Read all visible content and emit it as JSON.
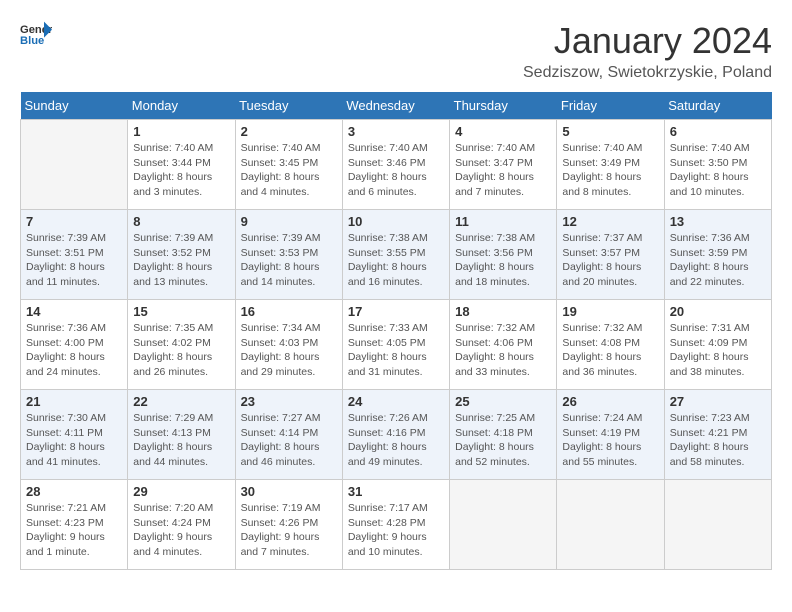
{
  "header": {
    "logo_line1": "General",
    "logo_line2": "Blue",
    "month_title": "January 2024",
    "location": "Sedziszow, Swietokrzyskie, Poland"
  },
  "weekdays": [
    "Sunday",
    "Monday",
    "Tuesday",
    "Wednesday",
    "Thursday",
    "Friday",
    "Saturday"
  ],
  "weeks": [
    [
      {
        "day": "",
        "info": ""
      },
      {
        "day": "1",
        "info": "Sunrise: 7:40 AM\nSunset: 3:44 PM\nDaylight: 8 hours\nand 3 minutes."
      },
      {
        "day": "2",
        "info": "Sunrise: 7:40 AM\nSunset: 3:45 PM\nDaylight: 8 hours\nand 4 minutes."
      },
      {
        "day": "3",
        "info": "Sunrise: 7:40 AM\nSunset: 3:46 PM\nDaylight: 8 hours\nand 6 minutes."
      },
      {
        "day": "4",
        "info": "Sunrise: 7:40 AM\nSunset: 3:47 PM\nDaylight: 8 hours\nand 7 minutes."
      },
      {
        "day": "5",
        "info": "Sunrise: 7:40 AM\nSunset: 3:49 PM\nDaylight: 8 hours\nand 8 minutes."
      },
      {
        "day": "6",
        "info": "Sunrise: 7:40 AM\nSunset: 3:50 PM\nDaylight: 8 hours\nand 10 minutes."
      }
    ],
    [
      {
        "day": "7",
        "info": "Sunrise: 7:39 AM\nSunset: 3:51 PM\nDaylight: 8 hours\nand 11 minutes."
      },
      {
        "day": "8",
        "info": "Sunrise: 7:39 AM\nSunset: 3:52 PM\nDaylight: 8 hours\nand 13 minutes."
      },
      {
        "day": "9",
        "info": "Sunrise: 7:39 AM\nSunset: 3:53 PM\nDaylight: 8 hours\nand 14 minutes."
      },
      {
        "day": "10",
        "info": "Sunrise: 7:38 AM\nSunset: 3:55 PM\nDaylight: 8 hours\nand 16 minutes."
      },
      {
        "day": "11",
        "info": "Sunrise: 7:38 AM\nSunset: 3:56 PM\nDaylight: 8 hours\nand 18 minutes."
      },
      {
        "day": "12",
        "info": "Sunrise: 7:37 AM\nSunset: 3:57 PM\nDaylight: 8 hours\nand 20 minutes."
      },
      {
        "day": "13",
        "info": "Sunrise: 7:36 AM\nSunset: 3:59 PM\nDaylight: 8 hours\nand 22 minutes."
      }
    ],
    [
      {
        "day": "14",
        "info": "Sunrise: 7:36 AM\nSunset: 4:00 PM\nDaylight: 8 hours\nand 24 minutes."
      },
      {
        "day": "15",
        "info": "Sunrise: 7:35 AM\nSunset: 4:02 PM\nDaylight: 8 hours\nand 26 minutes."
      },
      {
        "day": "16",
        "info": "Sunrise: 7:34 AM\nSunset: 4:03 PM\nDaylight: 8 hours\nand 29 minutes."
      },
      {
        "day": "17",
        "info": "Sunrise: 7:33 AM\nSunset: 4:05 PM\nDaylight: 8 hours\nand 31 minutes."
      },
      {
        "day": "18",
        "info": "Sunrise: 7:32 AM\nSunset: 4:06 PM\nDaylight: 8 hours\nand 33 minutes."
      },
      {
        "day": "19",
        "info": "Sunrise: 7:32 AM\nSunset: 4:08 PM\nDaylight: 8 hours\nand 36 minutes."
      },
      {
        "day": "20",
        "info": "Sunrise: 7:31 AM\nSunset: 4:09 PM\nDaylight: 8 hours\nand 38 minutes."
      }
    ],
    [
      {
        "day": "21",
        "info": "Sunrise: 7:30 AM\nSunset: 4:11 PM\nDaylight: 8 hours\nand 41 minutes."
      },
      {
        "day": "22",
        "info": "Sunrise: 7:29 AM\nSunset: 4:13 PM\nDaylight: 8 hours\nand 44 minutes."
      },
      {
        "day": "23",
        "info": "Sunrise: 7:27 AM\nSunset: 4:14 PM\nDaylight: 8 hours\nand 46 minutes."
      },
      {
        "day": "24",
        "info": "Sunrise: 7:26 AM\nSunset: 4:16 PM\nDaylight: 8 hours\nand 49 minutes."
      },
      {
        "day": "25",
        "info": "Sunrise: 7:25 AM\nSunset: 4:18 PM\nDaylight: 8 hours\nand 52 minutes."
      },
      {
        "day": "26",
        "info": "Sunrise: 7:24 AM\nSunset: 4:19 PM\nDaylight: 8 hours\nand 55 minutes."
      },
      {
        "day": "27",
        "info": "Sunrise: 7:23 AM\nSunset: 4:21 PM\nDaylight: 8 hours\nand 58 minutes."
      }
    ],
    [
      {
        "day": "28",
        "info": "Sunrise: 7:21 AM\nSunset: 4:23 PM\nDaylight: 9 hours\nand 1 minute."
      },
      {
        "day": "29",
        "info": "Sunrise: 7:20 AM\nSunset: 4:24 PM\nDaylight: 9 hours\nand 4 minutes."
      },
      {
        "day": "30",
        "info": "Sunrise: 7:19 AM\nSunset: 4:26 PM\nDaylight: 9 hours\nand 7 minutes."
      },
      {
        "day": "31",
        "info": "Sunrise: 7:17 AM\nSunset: 4:28 PM\nDaylight: 9 hours\nand 10 minutes."
      },
      {
        "day": "",
        "info": ""
      },
      {
        "day": "",
        "info": ""
      },
      {
        "day": "",
        "info": ""
      }
    ]
  ]
}
